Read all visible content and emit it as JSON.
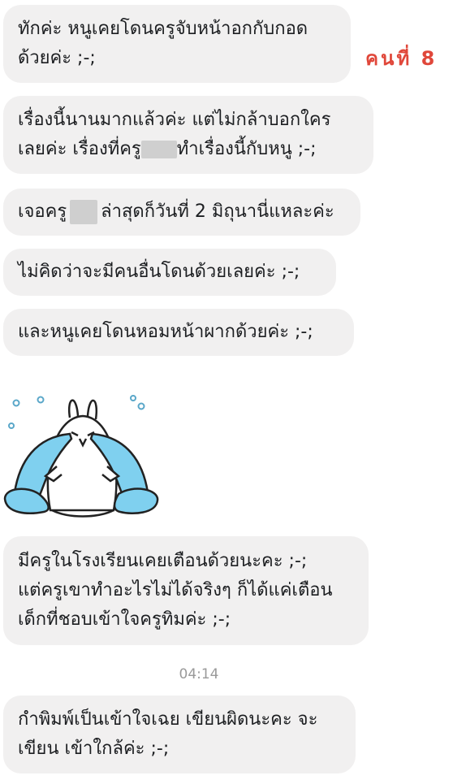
{
  "label": "คนที่ 8",
  "messages": [
    {
      "line1": "ทักค่ะ หนูเคยโดนครูจับหน้าอกกับกอด",
      "line2": "ด้วยค่ะ ;-;"
    },
    {
      "line1": "เรื่องนี้นานมากแล้วค่ะ แต่ไม่กล้าบอกใคร",
      "line2a": "เลยค่ะ เรื่องที่ครู",
      "line2b": "ทำเรื่องนี้กับหนู ;-;"
    },
    {
      "a": "เจอครู",
      "b": "ล่าสุดก็วันที่ 2 มิถุนานี่แหละค่ะ"
    },
    {
      "text": "ไม่คิดว่าจะมีคนอื่นโดนด้วยเลยค่ะ ;-;"
    },
    {
      "text": "และหนูเคยโดนหอมหน้าผากด้วยค่ะ ;-;"
    },
    {
      "line1": "มีครูในโรงเรียนเคยเตือนด้วยนะคะ ;-;",
      "line2": "แต่ครูเขาทำอะไรไม่ได้จริงๆ ก็ได้แค่เตือน",
      "line3": "เด็กที่ชอบเข้าใจครูทิมค่ะ ;-;"
    },
    {
      "line1": "กำพิมพ์เป็นเข้าใจเฉย เขียนผิดนะคะ จะ",
      "line2": "เขียน เข้าใกล้ค่ะ ;-;"
    }
  ],
  "timestamp": "04:14",
  "sticker": {
    "icon": "crying-rabbit-sticker"
  }
}
